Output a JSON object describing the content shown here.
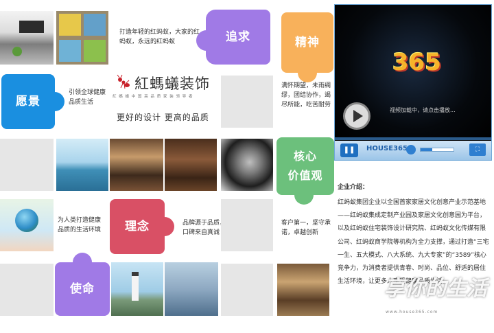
{
  "brand": {
    "name": "紅螞蟻装饰",
    "subtitle": "紅 螞 蟻 中 国 高 品 质 家 装 领 导 者",
    "slogan": "更好的设计  更高的品质"
  },
  "values": {
    "zhuiqiu": {
      "label": "追求",
      "text": "打造年轻的红蚂蚁，大家的红蚂蚁，永远的红蚂蚁"
    },
    "jingshen": {
      "label": "精神",
      "text": "满怀期望，未雨绸缪，团结协作，竭尽所能，吃苦耐劳"
    },
    "yuanjing": {
      "label": "愿景",
      "text": "引领全球健康品质生活"
    },
    "hexin": {
      "label_line1": "核心",
      "label_line2": "价值观",
      "text": "客户第一，坚守承诺，卓越创新"
    },
    "linian": {
      "label": "理念",
      "text": "品牌源于品质，口碑来自真诚"
    },
    "shiming": {
      "label": "使命",
      "text": "为人类打造健康品质的生活环境"
    }
  },
  "player": {
    "logo_text": "365",
    "notice": "视频加载中，请点击播放...",
    "brand": "HOUSE365",
    "pause_icon": "pause-icon",
    "fullscreen_icon": "fullscreen-icon",
    "seek_progress": 0.0,
    "volume_level": 0.35
  },
  "intro": {
    "title": "企业介绍：",
    "body": "红蚂蚁集团企业以全国首家家居文化创意产业示范基地——红蚂蚁集成定制产业园及家居文化创意园为平台，以及红蚂蚁住宅装饰设计研究院、红蚂蚁文化传媒有限公司、红蚂蚁商学院等机构为全力支撑，通过打造“三宅一生、五大模式、八大系统、九大专家”的“3589”核心竞争力，为消费者提供青春、时尚、品位、舒适的居住生活环境，让更多人享受健康品质生活。"
  },
  "watermark": {
    "text": "享你的生活",
    "url": "www.house365.com"
  },
  "colors": {
    "purple": "#a07ae6",
    "orange": "#f8b15b",
    "blue": "#1a8fe0",
    "green": "#6cc07c",
    "red": "#d95065"
  }
}
